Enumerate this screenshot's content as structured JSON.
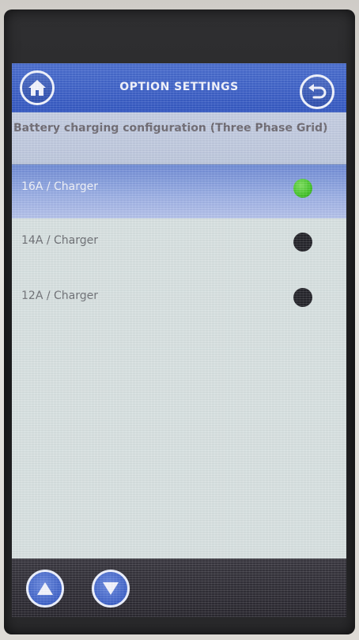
{
  "header": {
    "title": "OPTION SETTINGS",
    "home_icon": "home-icon",
    "back_icon": "return-arrow-icon"
  },
  "subtitle": "Battery charging configuration (Three Phase Grid)",
  "options": [
    {
      "label": "16A / Charger",
      "selected": true
    },
    {
      "label": "14A / Charger",
      "selected": false
    },
    {
      "label": "12A / Charger",
      "selected": false
    }
  ],
  "footer": {
    "up_icon": "triangle-up-icon",
    "down_icon": "triangle-down-icon"
  },
  "colors": {
    "header_blue": "#3559c3",
    "selected_row": "#7f99dc",
    "active_dot": "#45c52b",
    "inactive_dot": "#26262c"
  }
}
